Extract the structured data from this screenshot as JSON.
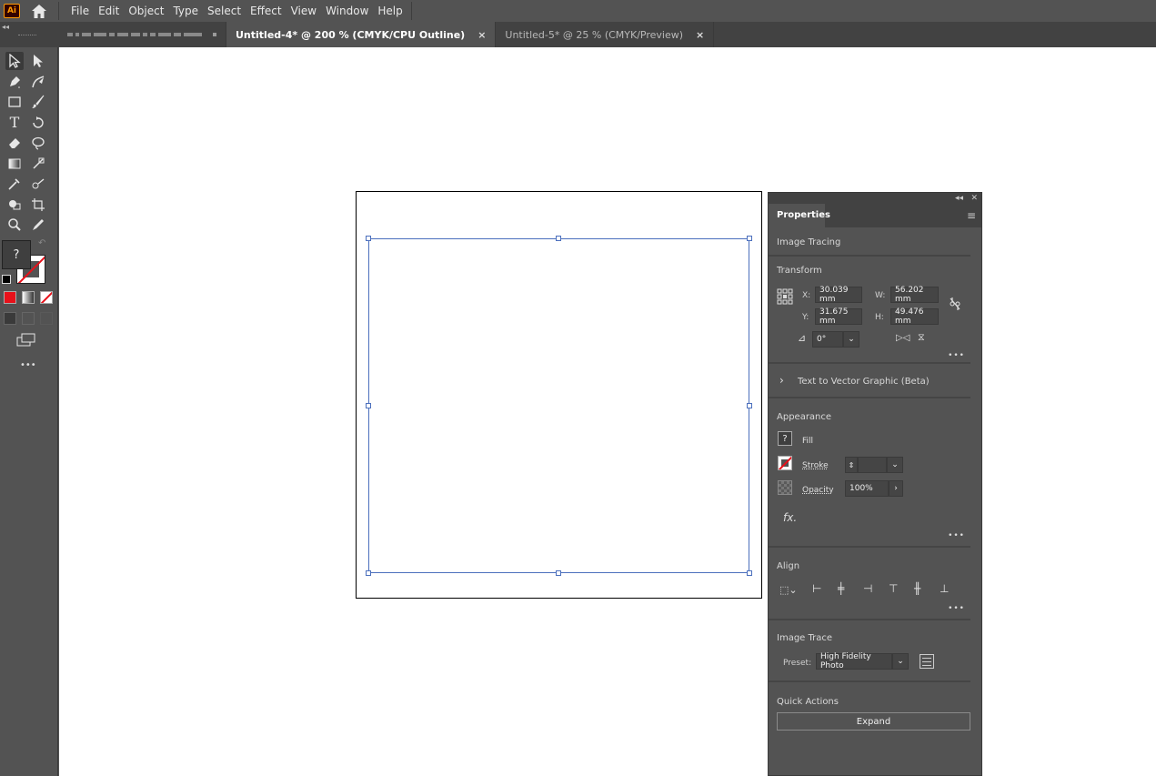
{
  "app": {
    "logo_text": "Ai",
    "menus": [
      "File",
      "Edit",
      "Object",
      "Type",
      "Select",
      "Effect",
      "View",
      "Window",
      "Help"
    ]
  },
  "tabs": [
    {
      "label": "Untitled-4* @ 200 % (CMYK/CPU Outline)",
      "active": true,
      "close": "×"
    },
    {
      "label": "Untitled-5* @ 25 % (CMYK/Preview)",
      "active": false,
      "close": "×"
    }
  ],
  "toolbar": {
    "fill_label": "?",
    "more": "•••"
  },
  "properties": {
    "tab_label": "Properties",
    "image_tracing": "Image Tracing",
    "transform": {
      "title": "Transform",
      "x_label": "X:",
      "x_value": "30.039 mm",
      "y_label": "Y:",
      "y_value": "31.675 mm",
      "w_label": "W:",
      "w_value": "56.202 mm",
      "h_label": "H:",
      "h_value": "49.476 mm",
      "rotate_value": "0°"
    },
    "text_to_vector": "Text to Vector Graphic (Beta)",
    "appearance": {
      "title": "Appearance",
      "fill_label": "Fill",
      "fill_swatch": "?",
      "stroke_label": "Stroke",
      "opacity_label": "Opacity",
      "opacity_value": "100%",
      "fx_label": "fx."
    },
    "align": {
      "title": "Align"
    },
    "image_trace": {
      "title": "Image Trace",
      "preset_label": "Preset:",
      "preset_value": "High Fidelity Photo"
    },
    "quick_actions": {
      "title": "Quick Actions",
      "expand_label": "Expand"
    },
    "more": "•••"
  },
  "colors": {
    "ui_bg": "#535353",
    "ui_dark": "#424242",
    "selection": "#4b6fbd",
    "none_red": "#e8111a",
    "logo": "#ff9a00"
  }
}
